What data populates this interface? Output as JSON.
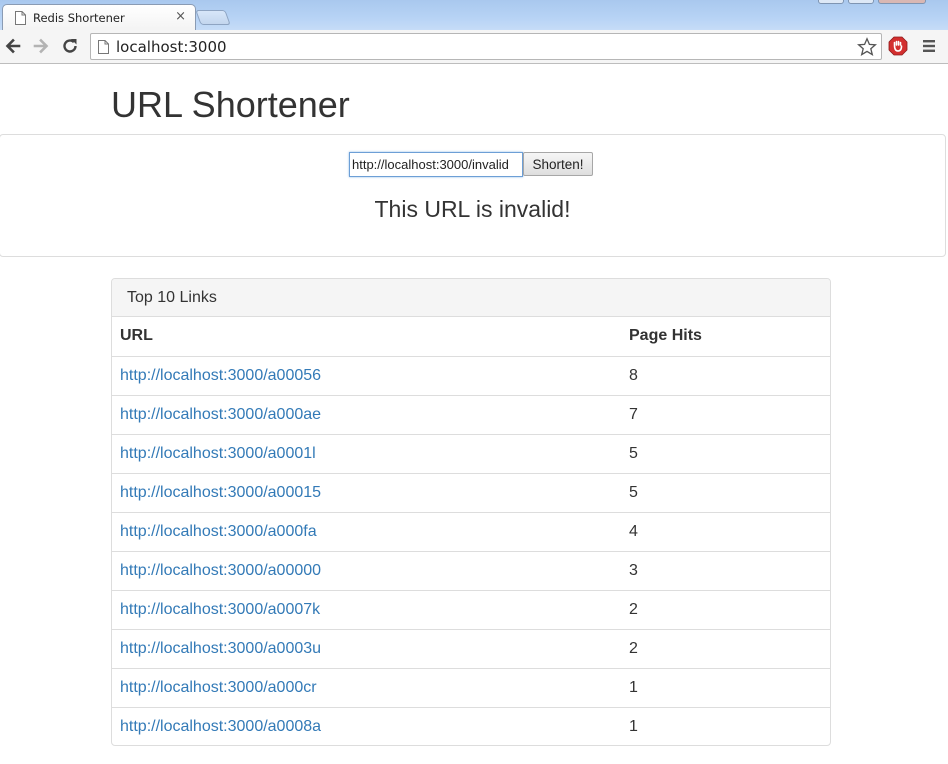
{
  "browser": {
    "tab_title": "Redis Shortener",
    "tab_close": "×",
    "address": "localhost:3000",
    "colors": {
      "accent": "#337ab7",
      "extension": "#d32f2f"
    }
  },
  "page": {
    "title": "URL Shortener",
    "form": {
      "input_value": "http://localhost:3000/invalid",
      "button_label": "Shorten!"
    },
    "message": "This URL is invalid!",
    "links_panel": {
      "heading": "Top 10 Links",
      "columns": [
        "URL",
        "Page Hits"
      ],
      "rows": [
        {
          "url": "http://localhost:3000/a00056",
          "hits": "8"
        },
        {
          "url": "http://localhost:3000/a000ae",
          "hits": "7"
        },
        {
          "url": "http://localhost:3000/a0001l",
          "hits": "5"
        },
        {
          "url": "http://localhost:3000/a00015",
          "hits": "5"
        },
        {
          "url": "http://localhost:3000/a000fa",
          "hits": "4"
        },
        {
          "url": "http://localhost:3000/a00000",
          "hits": "3"
        },
        {
          "url": "http://localhost:3000/a0007k",
          "hits": "2"
        },
        {
          "url": "http://localhost:3000/a0003u",
          "hits": "2"
        },
        {
          "url": "http://localhost:3000/a000cr",
          "hits": "1"
        },
        {
          "url": "http://localhost:3000/a0008a",
          "hits": "1"
        }
      ]
    }
  }
}
